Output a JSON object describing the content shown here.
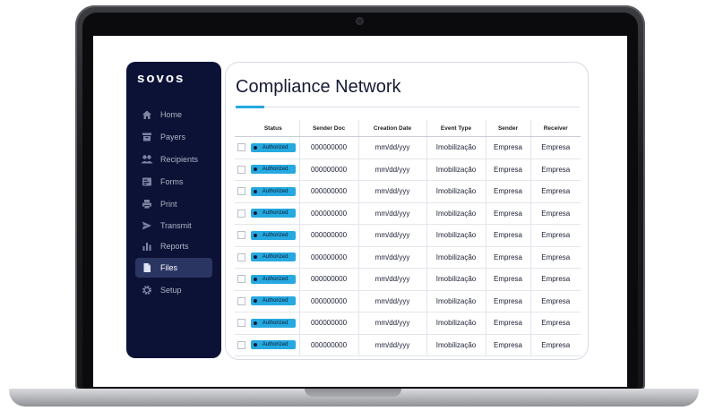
{
  "app": {
    "brand": "sovos",
    "page_title": "Compliance Network"
  },
  "sidebar": {
    "items": [
      {
        "label": "Home",
        "icon": "home-icon"
      },
      {
        "label": "Payers",
        "icon": "payers-icon"
      },
      {
        "label": "Recipients",
        "icon": "people-icon"
      },
      {
        "label": "Forms",
        "icon": "forms-icon"
      },
      {
        "label": "Print",
        "icon": "printer-icon"
      },
      {
        "label": "Transmit",
        "icon": "send-icon"
      },
      {
        "label": "Reports",
        "icon": "bar-chart-icon"
      },
      {
        "label": "Files",
        "icon": "file-icon",
        "active": true
      },
      {
        "label": "Setup",
        "icon": "gear-icon"
      }
    ]
  },
  "table": {
    "headers": [
      "Status",
      "Sender Doc",
      "Creation Date",
      "Event Type",
      "Sender",
      "Receiver"
    ],
    "rows": [
      {
        "status": "Authorized",
        "sender_doc": "000000000",
        "creation_date": "mm/dd/yyy",
        "event_type": "Imobilização",
        "sender": "Empresa",
        "receiver": "Empresa"
      },
      {
        "status": "Authorized",
        "sender_doc": "000000000",
        "creation_date": "mm/dd/yyy",
        "event_type": "Imobilização",
        "sender": "Empresa",
        "receiver": "Empresa"
      },
      {
        "status": "Authorized",
        "sender_doc": "000000000",
        "creation_date": "mm/dd/yyy",
        "event_type": "Imobilização",
        "sender": "Empresa",
        "receiver": "Empresa"
      },
      {
        "status": "Authorized",
        "sender_doc": "000000000",
        "creation_date": "mm/dd/yyy",
        "event_type": "Imobilização",
        "sender": "Empresa",
        "receiver": "Empresa"
      },
      {
        "status": "Authorized",
        "sender_doc": "000000000",
        "creation_date": "mm/dd/yyy",
        "event_type": "Imobilização",
        "sender": "Empresa",
        "receiver": "Empresa"
      },
      {
        "status": "Authorized",
        "sender_doc": "000000000",
        "creation_date": "mm/dd/yyy",
        "event_type": "Imobilização",
        "sender": "Empresa",
        "receiver": "Empresa"
      },
      {
        "status": "Authorized",
        "sender_doc": "000000000",
        "creation_date": "mm/dd/yyy",
        "event_type": "Imobilização",
        "sender": "Empresa",
        "receiver": "Empresa"
      },
      {
        "status": "Authorized",
        "sender_doc": "000000000",
        "creation_date": "mm/dd/yyy",
        "event_type": "Imobilização",
        "sender": "Empresa",
        "receiver": "Empresa"
      },
      {
        "status": "Authorized",
        "sender_doc": "000000000",
        "creation_date": "mm/dd/yyy",
        "event_type": "Imobilização",
        "sender": "Empresa",
        "receiver": "Empresa"
      },
      {
        "status": "Authorized",
        "sender_doc": "000000000",
        "creation_date": "mm/dd/yyy",
        "event_type": "Imobilização",
        "sender": "Empresa",
        "receiver": "Empresa"
      }
    ]
  },
  "colors": {
    "sidebar_bg": "#0c1236",
    "accent": "#25a9e0",
    "active_nav": "#2a3562"
  }
}
